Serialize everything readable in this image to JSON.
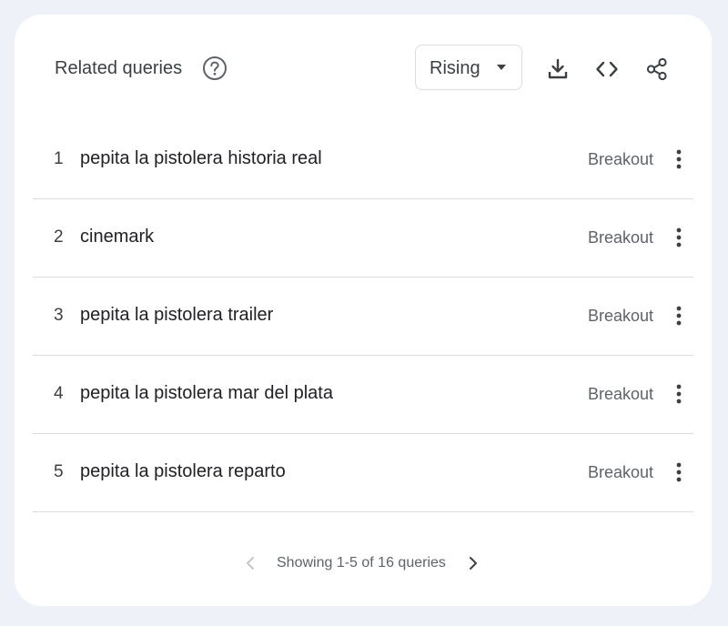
{
  "widget": {
    "title": "Related queries",
    "help_icon": "help-circle-icon"
  },
  "toolbar": {
    "dropdown_value": "Rising",
    "icons": [
      "download-icon",
      "embed-code-icon",
      "share-icon"
    ]
  },
  "queries": [
    {
      "rank": "1",
      "query": "pepita la pistolera historia real",
      "value": "Breakout"
    },
    {
      "rank": "2",
      "query": "cinemark",
      "value": "Breakout"
    },
    {
      "rank": "3",
      "query": "pepita la pistolera trailer",
      "value": "Breakout"
    },
    {
      "rank": "4",
      "query": "pepita la pistolera mar del plata",
      "value": "Breakout"
    },
    {
      "rank": "5",
      "query": "pepita la pistolera reparto",
      "value": "Breakout"
    }
  ],
  "pagination": {
    "text": "Showing 1-5 of 16 queries"
  },
  "colors": {
    "background": "#eef2f8",
    "card": "#ffffff",
    "divider": "#dadce0",
    "text_primary": "#202124",
    "text_secondary": "#5f6368"
  }
}
